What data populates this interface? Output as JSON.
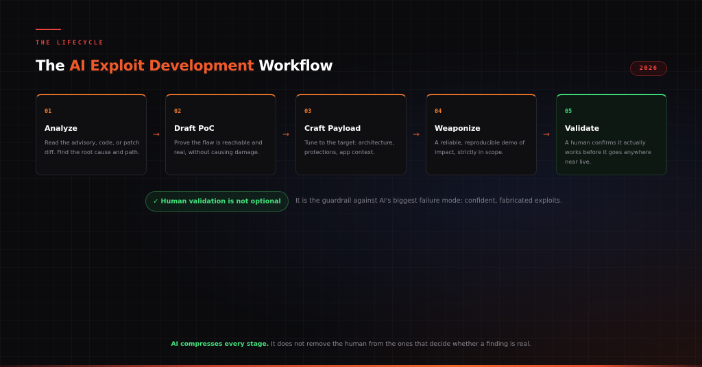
{
  "header": {
    "eyebrow": "THE LIFECYCLE",
    "title_prefix": "The ",
    "title_accent": "AI Exploit Development",
    "title_suffix": " Workflow",
    "year_badge": "2026"
  },
  "steps": [
    {
      "num": "01",
      "name": "Analyze",
      "desc": "Read the advisory, code, or patch diff. Find the root cause and path."
    },
    {
      "num": "02",
      "name": "Draft PoC",
      "desc": "Prove the flaw is reachable and real, without causing damage."
    },
    {
      "num": "03",
      "name": "Craft Payload",
      "desc": "Tune to the target: architecture, protections, app context."
    },
    {
      "num": "04",
      "name": "Weaponize",
      "desc": "A reliable, reproducible demo of impact, strictly in scope."
    },
    {
      "num": "05",
      "name": "Validate",
      "desc": "A human confirms it actually works before it goes anywhere near live."
    }
  ],
  "arrow_glyph": "→",
  "callout": {
    "pill": "✓ Human validation is not optional",
    "note": "It is the guardrail against AI's biggest failure mode: confident, fabricated exploits."
  },
  "footer": {
    "highlight": "AI compresses every stage.",
    "text": " It does not remove the human from the ones that decide whether a finding is real."
  },
  "colors": {
    "accent_red": "#e8453c",
    "accent_orange": "#f05a2b",
    "validate_green": "#3fd778",
    "background": "#0b0b0e"
  },
  "icons": [
    "check-icon",
    "arrow-right-icon"
  ]
}
